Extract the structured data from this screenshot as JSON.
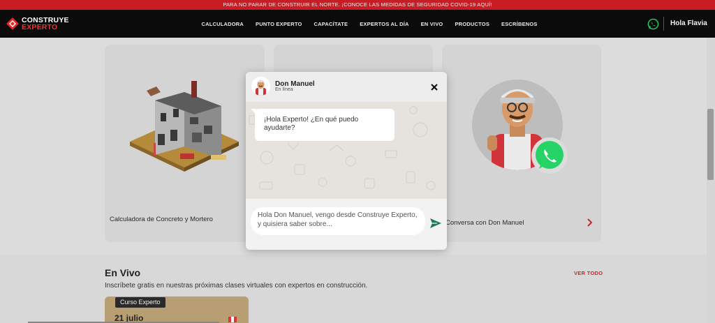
{
  "announcement": "PARA NO PARAR DE CONSTRUIR EL NORTE. ¡CONOCE LAS MEDIDAS DE SEGURIDAD COVID-19 AQUÍ!",
  "brand": {
    "line1": "CONSTRUYE",
    "line2": "EXPERTO"
  },
  "nav": {
    "items": [
      "CALCULADORA",
      "PUNTO EXPERTO",
      "CAPACÍTATE",
      "EXPERTOS AL DÍA",
      "EN VIVO",
      "PRODUCTOS",
      "ESCRÍBENOS"
    ],
    "greeting": "Hola Flavia"
  },
  "cards": {
    "calculator_label": "Calculadora de Concreto y Mortero",
    "conversation_label": "Conversa con Don Manuel"
  },
  "live": {
    "title": "En Vivo",
    "subtitle": "Inscríbete gratis en nuestras próximas clases virtuales con expertos en construcción.",
    "see_all": "VER TODO",
    "course_tag": "Curso Experto",
    "course_date": "21 julio"
  },
  "chat": {
    "agent_name": "Don Manuel",
    "agent_status": "En línea",
    "greeting_message": "¡Hola Experto! ¿En qué puedo ayudarte?",
    "input_value": "Hola Don Manuel, vengo desde Construye Experto, y quisiera saber sobre..."
  },
  "colors": {
    "brand_red": "#c81d25",
    "whatsapp_green": "#25d366",
    "send_green": "#1b7a4f",
    "nav_bg": "#0b0b0b"
  }
}
